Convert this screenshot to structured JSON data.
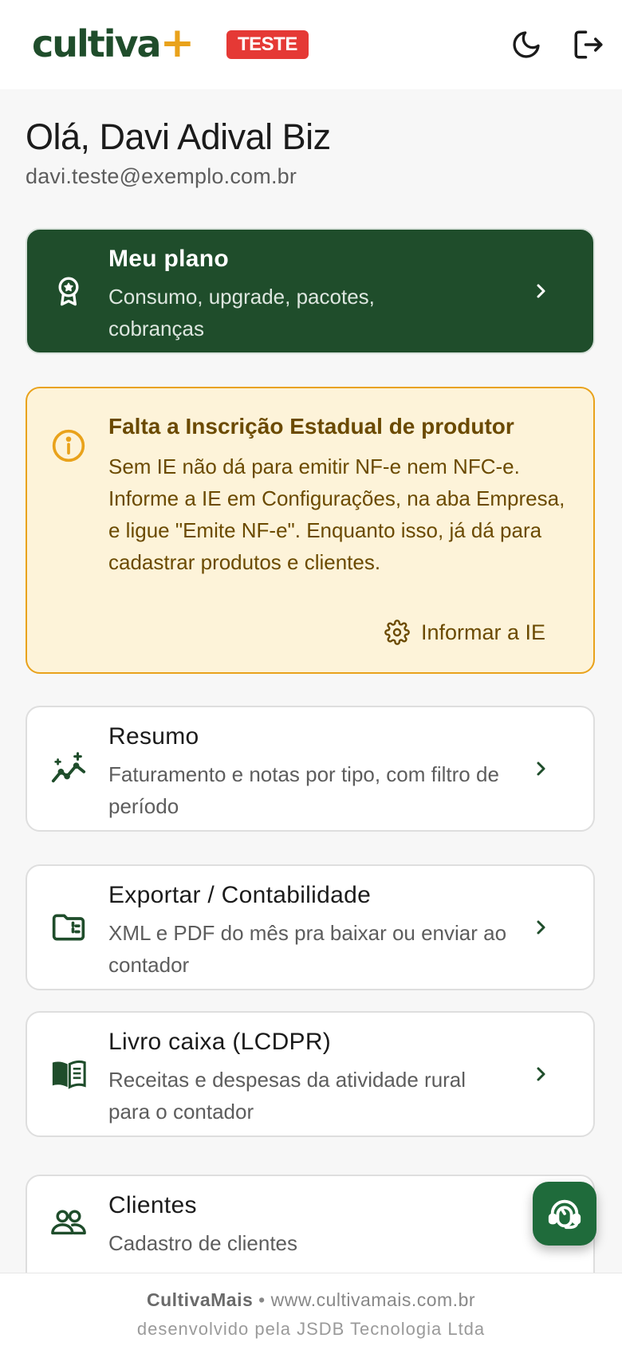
{
  "header": {
    "logo_text": "cultiva",
    "logo_plus": "+",
    "env_badge": "TESTE",
    "theme_icon": "moon-icon",
    "logout_icon": "logout-icon"
  },
  "user": {
    "greeting": "Olá, Davi Adival Biz",
    "email": "davi.teste@exemplo.com.br"
  },
  "plan": {
    "title": "Meu plano",
    "subtitle": "Consumo, upgrade, pacotes, cobranças",
    "icon": "award-badge-icon"
  },
  "warning": {
    "title": "Falta a Inscrição Estadual de produtor",
    "text": "Sem IE não dá para emitir NF-e nem NFC-e. Informe a IE em Configurações, na aba Empresa, e ligue \"Emite NF-e\". Enquanto isso, já dá para cadastrar produtos e clientes.",
    "action_label": "Informar a IE",
    "icon": "info-icon"
  },
  "menu": [
    {
      "title": "Resumo",
      "subtitle": "Faturamento e notas por tipo, com filtro de período",
      "icon": "chart-sparkle-icon"
    },
    {
      "title": "Exportar / Contabilidade",
      "subtitle": "XML e PDF do mês pra baixar ou enviar ao contador",
      "icon": "folder-export-icon"
    },
    {
      "title": "Livro caixa (LCDPR)",
      "subtitle": "Receitas e despesas da atividade rural para o contador",
      "icon": "book-icon"
    },
    {
      "title": "Clientes",
      "subtitle": "Cadastro de clientes",
      "icon": "users-icon"
    }
  ],
  "support_icon": "headset-support-icon",
  "footer": {
    "brand": "CultivaMais",
    "separator": " • ",
    "site": "www.cultivamais.com.br",
    "credit": "desenvolvido pela JSDB Tecnologia Ltda"
  },
  "colors": {
    "brand_green": "#1f4d2b",
    "accent_gold": "#e9a21b",
    "badge_red": "#e53935",
    "warning_bg": "#fdf3d9",
    "warning_text": "#6b4a00",
    "fab_green": "#1f6b3b"
  }
}
